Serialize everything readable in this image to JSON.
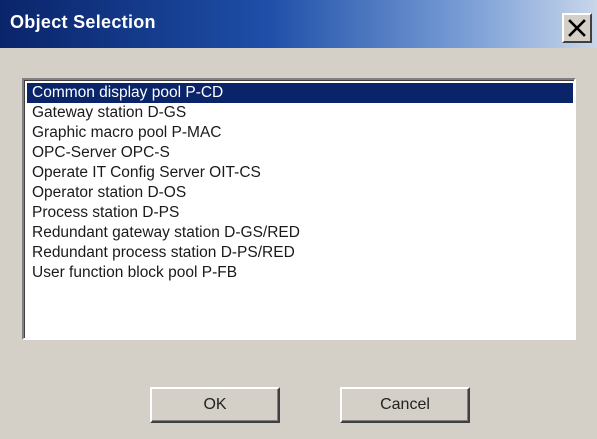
{
  "dialog": {
    "title": "Object Selection",
    "close_icon": "close-x-icon"
  },
  "list": {
    "selected_index": 0,
    "items": [
      {
        "label": "Common display pool P-CD"
      },
      {
        "label": "Gateway station D-GS"
      },
      {
        "label": "Graphic macro  pool P-MAC"
      },
      {
        "label": "OPC-Server OPC-S"
      },
      {
        "label": "Operate IT Config Server OIT-CS"
      },
      {
        "label": "Operator station D-OS"
      },
      {
        "label": "Process station D-PS"
      },
      {
        "label": "Redundant gateway station D-GS/RED"
      },
      {
        "label": "Redundant process station D-PS/RED"
      },
      {
        "label": "User function block pool P-FB"
      }
    ]
  },
  "buttons": {
    "ok_label": "OK",
    "cancel_label": "Cancel"
  },
  "colors": {
    "selection": "#0a246a",
    "title_gradient_start": "#0a246a",
    "face": "#d4d0c8"
  }
}
